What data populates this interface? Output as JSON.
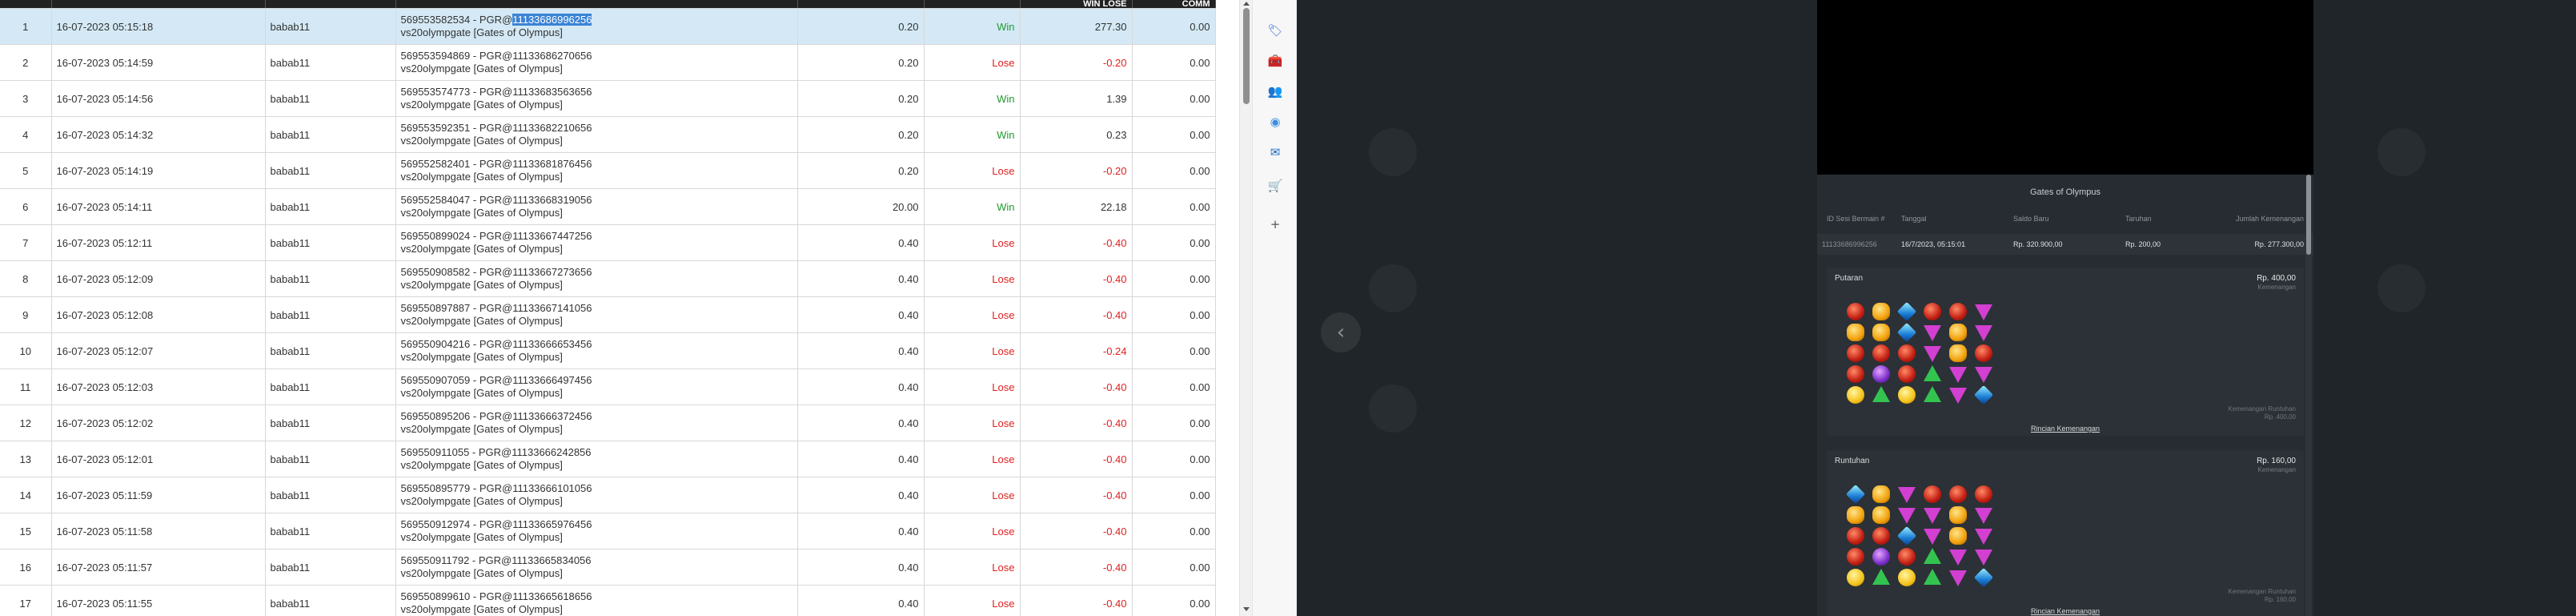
{
  "table": {
    "header": [
      "",
      "",
      "",
      "",
      "",
      "",
      "WIN LOSE",
      "COMM"
    ],
    "rows": [
      {
        "no": "1",
        "date": "16-07-2023 05:15:18",
        "user": "babab11",
        "id_prefix": "569553582534 - PGR@",
        "id_suffix": "11133686996256",
        "game": "vs20olympgate [Gates of Olympus]",
        "bet": "0.20",
        "status": "Win",
        "winlose": "277.30",
        "comm": "0.00"
      },
      {
        "no": "2",
        "date": "16-07-2023 05:14:59",
        "user": "babab11",
        "id_prefix": "569553594869 - PGR@",
        "id_suffix": "11133686270656",
        "game": "vs20olympgate [Gates of Olympus]",
        "bet": "0.20",
        "status": "Lose",
        "winlose": "-0.20",
        "comm": "0.00"
      },
      {
        "no": "3",
        "date": "16-07-2023 05:14:56",
        "user": "babab11",
        "id_prefix": "569553574773 - PGR@",
        "id_suffix": "11133683563656",
        "game": "vs20olympgate [Gates of Olympus]",
        "bet": "0.20",
        "status": "Win",
        "winlose": "1.39",
        "comm": "0.00"
      },
      {
        "no": "4",
        "date": "16-07-2023 05:14:32",
        "user": "babab11",
        "id_prefix": "569553592351 - PGR@",
        "id_suffix": "11133682210656",
        "game": "vs20olympgate [Gates of Olympus]",
        "bet": "0.20",
        "status": "Win",
        "winlose": "0.23",
        "comm": "0.00"
      },
      {
        "no": "5",
        "date": "16-07-2023 05:14:19",
        "user": "babab11",
        "id_prefix": "569552582401 - PGR@",
        "id_suffix": "11133681876456",
        "game": "vs20olympgate [Gates of Olympus]",
        "bet": "0.20",
        "status": "Lose",
        "winlose": "-0.20",
        "comm": "0.00"
      },
      {
        "no": "6",
        "date": "16-07-2023 05:14:11",
        "user": "babab11",
        "id_prefix": "569552584047 - PGR@",
        "id_suffix": "11133668319056",
        "game": "vs20olympgate [Gates of Olympus]",
        "bet": "20.00",
        "status": "Win",
        "winlose": "22.18",
        "comm": "0.00"
      },
      {
        "no": "7",
        "date": "16-07-2023 05:12:11",
        "user": "babab11",
        "id_prefix": "569550899024 - PGR@",
        "id_suffix": "11133667447256",
        "game": "vs20olympgate [Gates of Olympus]",
        "bet": "0.40",
        "status": "Lose",
        "winlose": "-0.40",
        "comm": "0.00"
      },
      {
        "no": "8",
        "date": "16-07-2023 05:12:09",
        "user": "babab11",
        "id_prefix": "569550908582 - PGR@",
        "id_suffix": "11133667273656",
        "game": "vs20olympgate [Gates of Olympus]",
        "bet": "0.40",
        "status": "Lose",
        "winlose": "-0.40",
        "comm": "0.00"
      },
      {
        "no": "9",
        "date": "16-07-2023 05:12:08",
        "user": "babab11",
        "id_prefix": "569550897887 - PGR@",
        "id_suffix": "11133667141056",
        "game": "vs20olympgate [Gates of Olympus]",
        "bet": "0.40",
        "status": "Lose",
        "winlose": "-0.40",
        "comm": "0.00"
      },
      {
        "no": "10",
        "date": "16-07-2023 05:12:07",
        "user": "babab11",
        "id_prefix": "569550904216 - PGR@",
        "id_suffix": "11133666653456",
        "game": "vs20olympgate [Gates of Olympus]",
        "bet": "0.40",
        "status": "Lose",
        "winlose": "-0.24",
        "comm": "0.00"
      },
      {
        "no": "11",
        "date": "16-07-2023 05:12:03",
        "user": "babab11",
        "id_prefix": "569550907059 - PGR@",
        "id_suffix": "11133666497456",
        "game": "vs20olympgate [Gates of Olympus]",
        "bet": "0.40",
        "status": "Lose",
        "winlose": "-0.40",
        "comm": "0.00"
      },
      {
        "no": "12",
        "date": "16-07-2023 05:12:02",
        "user": "babab11",
        "id_prefix": "569550895206 - PGR@",
        "id_suffix": "11133666372456",
        "game": "vs20olympgate [Gates of Olympus]",
        "bet": "0.40",
        "status": "Lose",
        "winlose": "-0.40",
        "comm": "0.00"
      },
      {
        "no": "13",
        "date": "16-07-2023 05:12:01",
        "user": "babab11",
        "id_prefix": "569550911055 - PGR@",
        "id_suffix": "11133666242856",
        "game": "vs20olympgate [Gates of Olympus]",
        "bet": "0.40",
        "status": "Lose",
        "winlose": "-0.40",
        "comm": "0.00"
      },
      {
        "no": "14",
        "date": "16-07-2023 05:11:59",
        "user": "babab11",
        "id_prefix": "569550895779 - PGR@",
        "id_suffix": "11133666101056",
        "game": "vs20olympgate [Gates of Olympus]",
        "bet": "0.40",
        "status": "Lose",
        "winlose": "-0.40",
        "comm": "0.00"
      },
      {
        "no": "15",
        "date": "16-07-2023 05:11:58",
        "user": "babab11",
        "id_prefix": "569550912974 - PGR@",
        "id_suffix": "11133665976456",
        "game": "vs20olympgate [Gates of Olympus]",
        "bet": "0.40",
        "status": "Lose",
        "winlose": "-0.40",
        "comm": "0.00"
      },
      {
        "no": "16",
        "date": "16-07-2023 05:11:57",
        "user": "babab11",
        "id_prefix": "569550911792 - PGR@",
        "id_suffix": "11133665834056",
        "game": "vs20olympgate [Gates of Olympus]",
        "bet": "0.40",
        "status": "Lose",
        "winlose": "-0.40",
        "comm": "0.00"
      },
      {
        "no": "17",
        "date": "16-07-2023 05:11:55",
        "user": "babab11",
        "id_prefix": "569550899610 - PGR@",
        "id_suffix": "11133665618656",
        "game": "vs20olympgate [Gates of Olympus]",
        "bet": "0.40",
        "status": "Lose",
        "winlose": "-0.40",
        "comm": "0.00"
      }
    ]
  },
  "colors": {
    "win": "#1e9b2e",
    "lose": "#e02020",
    "selected_row": "#d4e9f5",
    "highlight": "#3b83d6",
    "dark_bg": "#1f2528"
  },
  "toolbar": {
    "icons": [
      {
        "name": "tag-icon",
        "glyph": "🏷",
        "color": "#3b6fd8"
      },
      {
        "name": "toolbox-icon",
        "glyph": "🧰",
        "color": "#d8502a"
      },
      {
        "name": "people-icon",
        "glyph": "👥",
        "color": "#7a4ac8"
      },
      {
        "name": "copilot-icon",
        "glyph": "◉",
        "color": "#3b8fe0"
      },
      {
        "name": "outlook-icon",
        "glyph": "✉",
        "color": "#1a6cc4"
      },
      {
        "name": "shopping-icon",
        "glyph": "🛒",
        "color": "#20a0a0"
      },
      {
        "name": "add-icon",
        "glyph": "+",
        "color": "#555555"
      }
    ]
  },
  "game": {
    "title": "Gates of Olympus",
    "summary_headers": [
      "ID Sesi Bermain #",
      "Tanggal",
      "Saldo Baru",
      "Taruhan",
      "Jumlah Kemenangan"
    ],
    "summary_values": [
      "11133686996256",
      "16/7/2023, 05:15:01",
      "Rp. 320.900,00",
      "Rp. 200,00",
      "Rp. 277.300,00"
    ],
    "panels": [
      {
        "title": "Putaran",
        "amount": "Rp. 400,00",
        "sub": "Kemenangan",
        "right_label": "Kemenangan Runtuhan",
        "right_value": "Rp. 400,00",
        "link": "Rincian Kemenangan",
        "grid": [
          [
            "red",
            "orange",
            "blue",
            "red",
            "red",
            "pink"
          ],
          [
            "orange",
            "orange",
            "blue",
            "pink",
            "orange",
            "pink"
          ],
          [
            "red",
            "red",
            "red",
            "pink",
            "orange",
            "red"
          ],
          [
            "red",
            "purple",
            "red",
            "green",
            "pink",
            "pink"
          ],
          [
            "yellow",
            "green",
            "yellow",
            "green",
            "pink",
            "blue"
          ]
        ]
      },
      {
        "title": "Runtuhan",
        "amount": "Rp. 160,00",
        "sub": "Kemenangan",
        "right_label": "Kemenangan Runtuhan",
        "right_value": "Rp. 160,00",
        "link": "Rincian Kemenangan",
        "grid": [
          [
            "blue",
            "orange",
            "pink",
            "red",
            "red",
            "red"
          ],
          [
            "orange",
            "orange",
            "pink",
            "pink",
            "orange",
            "pink"
          ],
          [
            "red",
            "red",
            "blue",
            "pink",
            "orange",
            "pink"
          ],
          [
            "red",
            "purple",
            "red",
            "green",
            "pink",
            "pink"
          ],
          [
            "yellow",
            "green",
            "yellow",
            "green",
            "pink",
            "blue"
          ]
        ]
      }
    ]
  }
}
